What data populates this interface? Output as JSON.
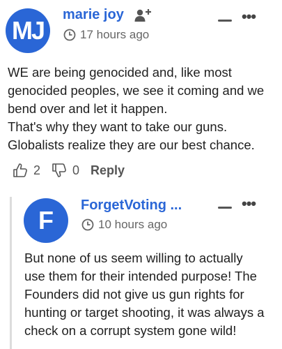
{
  "comment": {
    "avatar_text": "MJ",
    "username": "marie joy",
    "time": "17 hours ago",
    "body_lines": [
      "WE are being genocided and, like most",
      "genocided peoples, we see it coming and we",
      "bend over and let it happen.",
      "That's why they want to take our guns.",
      "Globalists realize they are our best chance."
    ],
    "upvotes": "2",
    "downvotes": "0",
    "reply_label": "Reply"
  },
  "reply": {
    "avatar_text": "F",
    "username": "ForgetVoting ...",
    "time": "10 hours ago",
    "body_lines": [
      "But none of us seem willing to actually",
      "use them for their intended purpose! The",
      "Founders did not give us gun rights for",
      "hunting or target shooting, it was always a",
      "check on a corrupt system gone wild!"
    ]
  },
  "colors": {
    "accent": "#2a66d6",
    "text": "#1f1f1f",
    "muted": "#666666"
  },
  "icons": {
    "follow": "follow-user-icon",
    "clock": "clock-icon",
    "upvote": "thumbs-up-icon",
    "downvote": "thumbs-down-icon",
    "collapse": "minus-icon",
    "more": "more-dots-icon"
  }
}
